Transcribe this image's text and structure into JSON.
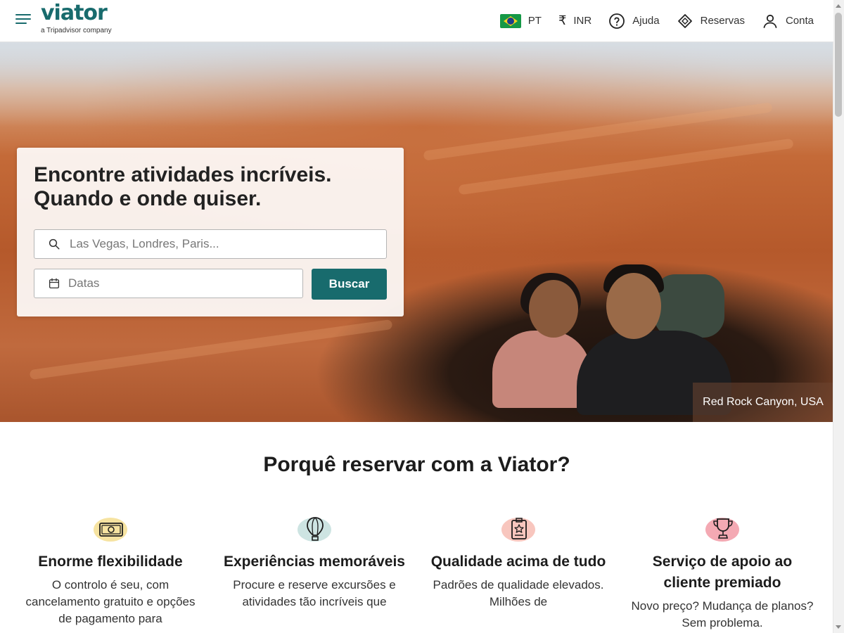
{
  "header": {
    "logo": "viator",
    "logo_tagline": "a Tripadvisor company",
    "language": "PT",
    "currency_symbol": "₹",
    "currency": "INR",
    "help": "Ajuda",
    "bookings": "Reservas",
    "account": "Conta"
  },
  "hero": {
    "title": "Encontre atividades incríveis. Quando e onde quiser.",
    "destination_placeholder": "Las Vegas, Londres, Paris...",
    "dates_label": "Datas",
    "search_button": "Buscar",
    "caption": "Red Rock Canyon, USA"
  },
  "why": {
    "title": "Porquê reservar com a Viator?",
    "features": [
      {
        "title": "Enorme flexibilidade",
        "text": "O controlo é seu, com cancelamento gratuito e opções de pagamento para",
        "icon": "money-icon",
        "color": "#f6e3a1"
      },
      {
        "title": "Experiências memoráveis",
        "text": "Procure e reserve excursões e atividades tão incríveis que",
        "icon": "balloon-icon",
        "color": "#cde4e2"
      },
      {
        "title": "Qualidade acima de tudo",
        "text": "Padrões de qualidade elevados. Milhões de",
        "icon": "badge-star-icon",
        "color": "#f8c6be"
      },
      {
        "title": "Serviço de apoio ao cliente premiado",
        "text": "Novo preço? Mudança de planos? Sem problema.",
        "icon": "trophy-icon",
        "color": "#f4a9b3"
      }
    ]
  },
  "colors": {
    "brand": "#186b6d",
    "text": "#1c1c1c"
  }
}
